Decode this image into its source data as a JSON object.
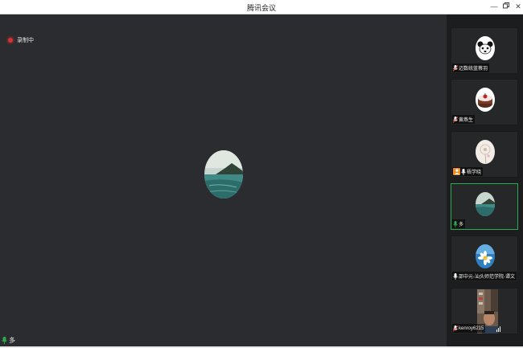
{
  "window": {
    "title": "腾讯会议"
  },
  "recording": {
    "label": "录制中",
    "color": "#d93030"
  },
  "main_speaker": {
    "name": "多"
  },
  "participants": [
    {
      "name": "迈数统蓝蔡羽",
      "avatar": "panda-face-icon",
      "mic": "muted"
    },
    {
      "name": "黄燕生",
      "avatar": "cake-icon",
      "mic": "muted"
    },
    {
      "name": "梧学晓",
      "avatar": "dandelion-icon",
      "mic": "on",
      "host": true
    },
    {
      "name": "多",
      "avatar": "seascape-icon",
      "mic": "speaking",
      "active": true
    },
    {
      "name": "邵中元-汕头师范学院-谭文",
      "avatar": "daisy-icon",
      "mic": "on"
    },
    {
      "name": "kenroy6215",
      "avatar": "video-feed",
      "mic": "muted"
    }
  ],
  "colors": {
    "active_border": "#2fa84f",
    "host_badge": "#f08a24",
    "mic_on": "#2fa84f",
    "mic_muted": "#ff4d4d"
  }
}
